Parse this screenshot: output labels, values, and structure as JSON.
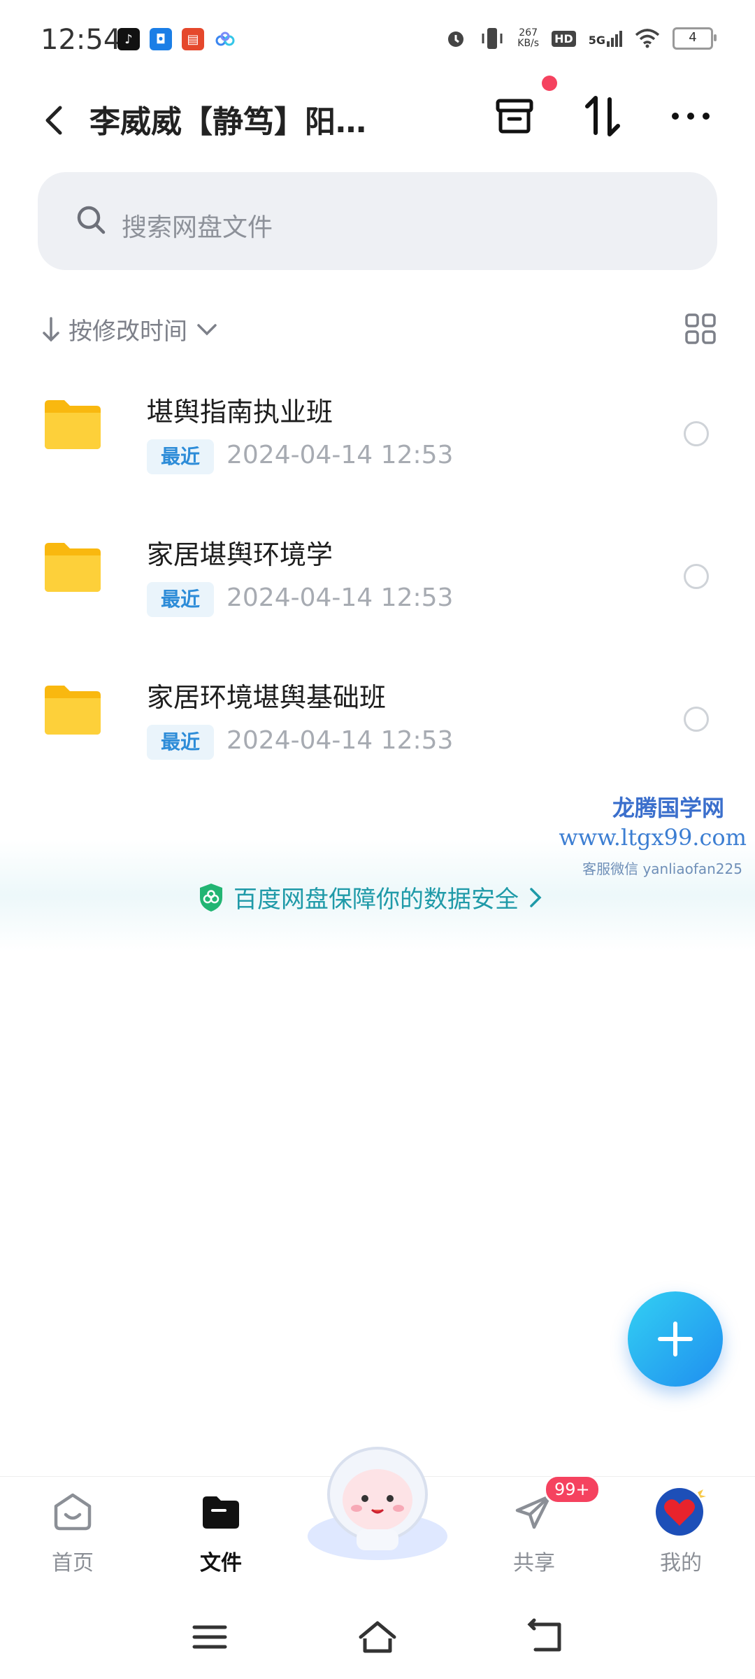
{
  "status": {
    "time": "12:54",
    "net_speed_value": "267",
    "net_speed_unit": "KB/s",
    "hd": "HD",
    "network": "5G",
    "battery": "4"
  },
  "header": {
    "title": "李威威【静笃】阳…"
  },
  "search": {
    "placeholder": "搜索网盘文件"
  },
  "sort": {
    "label": "按修改时间"
  },
  "files": [
    {
      "name": "堪舆指南执业班",
      "tag": "最近",
      "date": "2024-04-14  12:53"
    },
    {
      "name": "家居堪舆环境学",
      "tag": "最近",
      "date": "2024-04-14  12:53"
    },
    {
      "name": "家居环境堪舆基础班",
      "tag": "最近",
      "date": "2024-04-14  12:53"
    }
  ],
  "watermark": {
    "line1": "龙腾国学网",
    "line2": "www.ltgx99.com",
    "line3": "客服微信 yanliaofan225"
  },
  "safety_banner": {
    "text": "百度网盘保障你的数据安全"
  },
  "tabs": [
    {
      "label": "首页"
    },
    {
      "label": "文件"
    },
    {
      "label": "共享"
    },
    {
      "label": "我的"
    }
  ],
  "share_badge": "99+",
  "colors": {
    "accent": "#1f8ef0",
    "badge": "#f5425f",
    "folder": "#fdc61c",
    "safe_text": "#1f9aa8"
  }
}
